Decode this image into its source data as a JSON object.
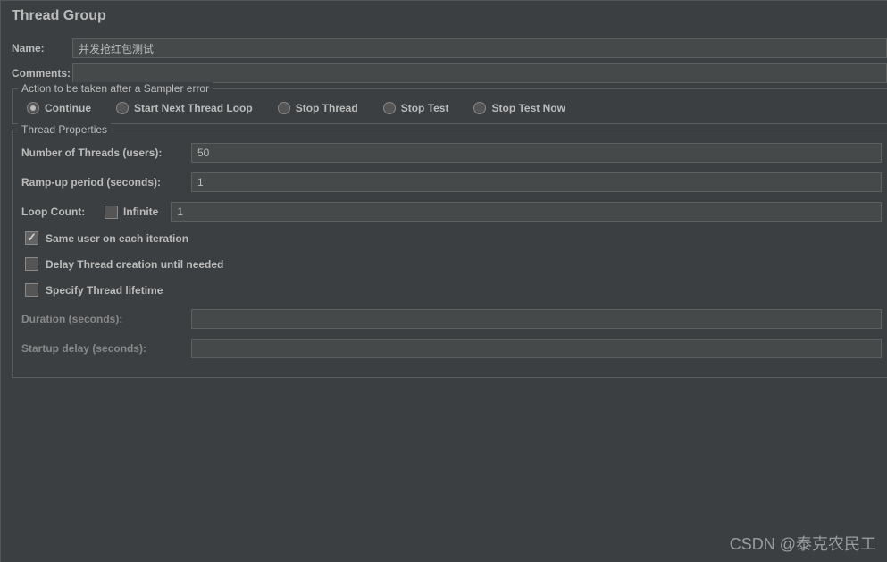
{
  "title": "Thread Group",
  "nameLabel": "Name:",
  "nameValue": "并发抢红包测试",
  "commentsLabel": "Comments:",
  "commentsValue": "",
  "samplerError": {
    "legend": "Action to be taken after a Sampler error",
    "options": [
      {
        "label": "Continue",
        "selected": true
      },
      {
        "label": "Start Next Thread Loop",
        "selected": false
      },
      {
        "label": "Stop Thread",
        "selected": false
      },
      {
        "label": "Stop Test",
        "selected": false
      },
      {
        "label": "Stop Test Now",
        "selected": false
      }
    ]
  },
  "threadProps": {
    "legend": "Thread Properties",
    "numThreadsLabel": "Number of Threads (users):",
    "numThreadsValue": "50",
    "rampUpLabel": "Ramp-up period (seconds):",
    "rampUpValue": "1",
    "loopCountLabel": "Loop Count:",
    "infiniteLabel": "Infinite",
    "infiniteChecked": false,
    "loopCountValue": "1",
    "sameUserLabel": "Same user on each iteration",
    "sameUserChecked": true,
    "delayCreationLabel": "Delay Thread creation until needed",
    "delayCreationChecked": false,
    "specifyLifetimeLabel": "Specify Thread lifetime",
    "specifyLifetimeChecked": false,
    "durationLabel": "Duration (seconds):",
    "durationValue": "",
    "startupDelayLabel": "Startup delay (seconds):",
    "startupDelayValue": ""
  },
  "watermark": "CSDN @泰克农民工"
}
